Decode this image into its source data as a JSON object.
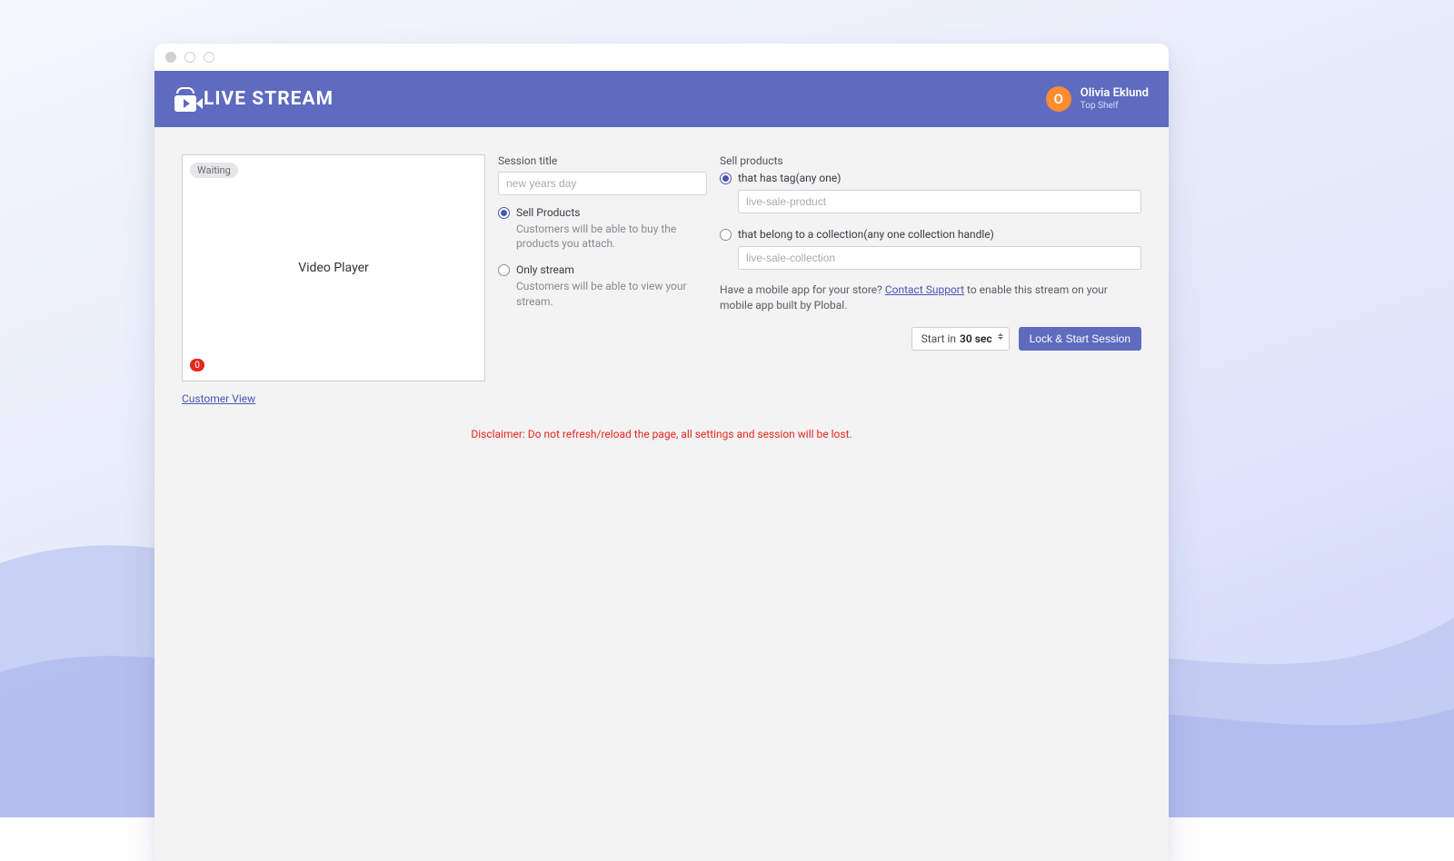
{
  "brand": {
    "name": "LIVE STREAM"
  },
  "user": {
    "name": "Olivia Eklund",
    "sub": "Top Shelf",
    "initial": "O"
  },
  "video": {
    "status": "Waiting",
    "label": "Video Player",
    "viewers": "0"
  },
  "customer_view_link": "Customer View",
  "session": {
    "title_label": "Session title",
    "title_placeholder": "new years day",
    "sell": {
      "label": "Sell Products",
      "desc": "Customers will be able to buy the products you attach."
    },
    "only": {
      "label": "Only stream",
      "desc": "Customers will be able to view your stream."
    }
  },
  "sell_products": {
    "heading": "Sell products",
    "tag": {
      "label": "that has tag(any one)",
      "placeholder": "live-sale-product"
    },
    "collection": {
      "label": "that belong to a collection(any one collection handle)",
      "placeholder": "live-sale-collection"
    }
  },
  "support_note": {
    "pre": "Have a mobile app for your store? ",
    "link": "Contact Support",
    "post": " to enable this stream on your mobile app built by Plobal."
  },
  "actions": {
    "delay_prefix": "Start in",
    "delay_value": "30 sec",
    "primary": "Lock & Start Session"
  },
  "disclaimer": "Disclaimer: Do not refresh/reload the page, all settings and session will be lost."
}
